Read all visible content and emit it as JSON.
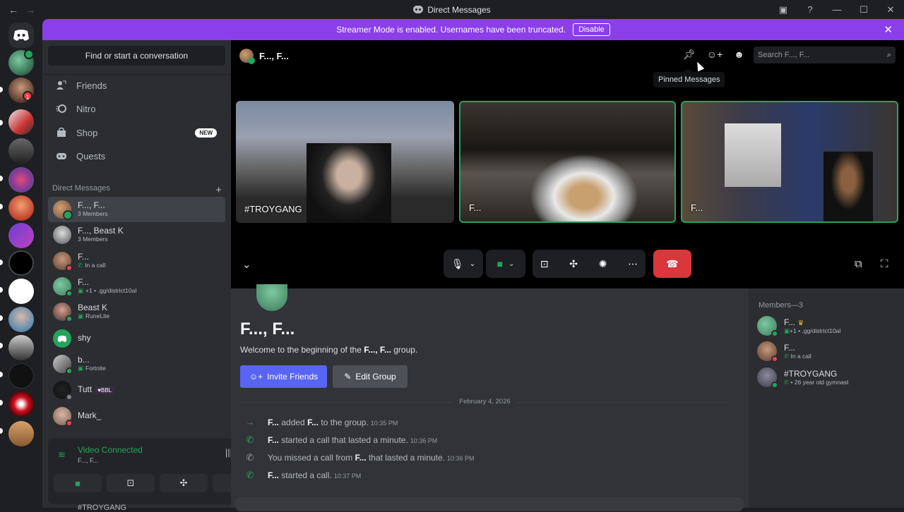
{
  "window": {
    "title": "Direct Messages",
    "back": "←",
    "forward": "→",
    "controls": [
      "▣",
      "?",
      "—",
      "☐",
      "✕"
    ]
  },
  "banner": {
    "text": "Streamer Mode is enabled. Usernames have been truncated.",
    "disable_label": "Disable",
    "close": "✕"
  },
  "guilds": {
    "badge_count": "1"
  },
  "sidebar": {
    "search_label": "Find or start a conversation",
    "nav": [
      {
        "label": "Friends",
        "icon": "friends-icon"
      },
      {
        "label": "Nitro",
        "icon": "nitro-icon"
      },
      {
        "label": "Shop",
        "icon": "shop-icon",
        "badge": "NEW"
      },
      {
        "label": "Quests",
        "icon": "quests-icon"
      }
    ],
    "dm_header": "Direct Messages",
    "dm_add": "+",
    "dms": [
      {
        "name": "F..., F...",
        "sub": "3 Members"
      },
      {
        "name": "F..., Beast K",
        "sub": "3 Members"
      },
      {
        "name": "F...",
        "sub": "In a call"
      },
      {
        "name": "F...",
        "sub": "+1 • .gg/district10al"
      },
      {
        "name": "Beast K",
        "sub": "RuneLite"
      },
      {
        "name": "shy",
        "sub": ""
      },
      {
        "name": "b...",
        "sub": "Fortnite"
      },
      {
        "name": "Tutt",
        "sub": "",
        "tag": "BBL"
      },
      {
        "name": "Mark_",
        "sub": ""
      }
    ],
    "voice": {
      "status": "Video Connected",
      "channel": "F..., F..."
    },
    "bottom_user": "#TROYGANG"
  },
  "call": {
    "title": "F..., F...",
    "search_placeholder": "Search F..., F...",
    "tooltip": "Pinned Messages",
    "tiles": [
      {
        "label": "#TROYGANG"
      },
      {
        "label": "F..."
      },
      {
        "label": "F..."
      }
    ]
  },
  "chat": {
    "title": "F..., F...",
    "welcome_prefix": "Welcome to the beginning of the ",
    "welcome_name": "F..., F...",
    "welcome_suffix": " group.",
    "invite_label": "Invite Friends",
    "edit_label": "Edit Group",
    "date": "February 4, 2026",
    "messages": [
      {
        "a": "F...",
        "mid": " added ",
        "b": "F...",
        "end": " to the group.",
        "time": "10:35 PM"
      },
      {
        "a": "F...",
        "mid": " started a call that lasted a minute.",
        "b": "",
        "end": "",
        "time": "10:36 PM"
      },
      {
        "a": "",
        "mid": "You missed a call from ",
        "b": "F...",
        "end": " that lasted a minute.",
        "time": "10:36 PM"
      },
      {
        "a": "F...",
        "mid": " started a call.",
        "b": "",
        "end": "",
        "time": "10:37 PM"
      }
    ]
  },
  "members": {
    "header": "Members—3",
    "list": [
      {
        "name": "F...",
        "sub": "+1 • .gg/district10al"
      },
      {
        "name": "F...",
        "sub": "In a call"
      },
      {
        "name": "#TROYGANG",
        "sub": "• 26 year old gymnast"
      }
    ]
  },
  "colors": {
    "brand": "#5865f2",
    "banner": "#8b3fe8",
    "online": "#23a55a",
    "dnd": "#f23f43",
    "end_call": "#da373c"
  }
}
